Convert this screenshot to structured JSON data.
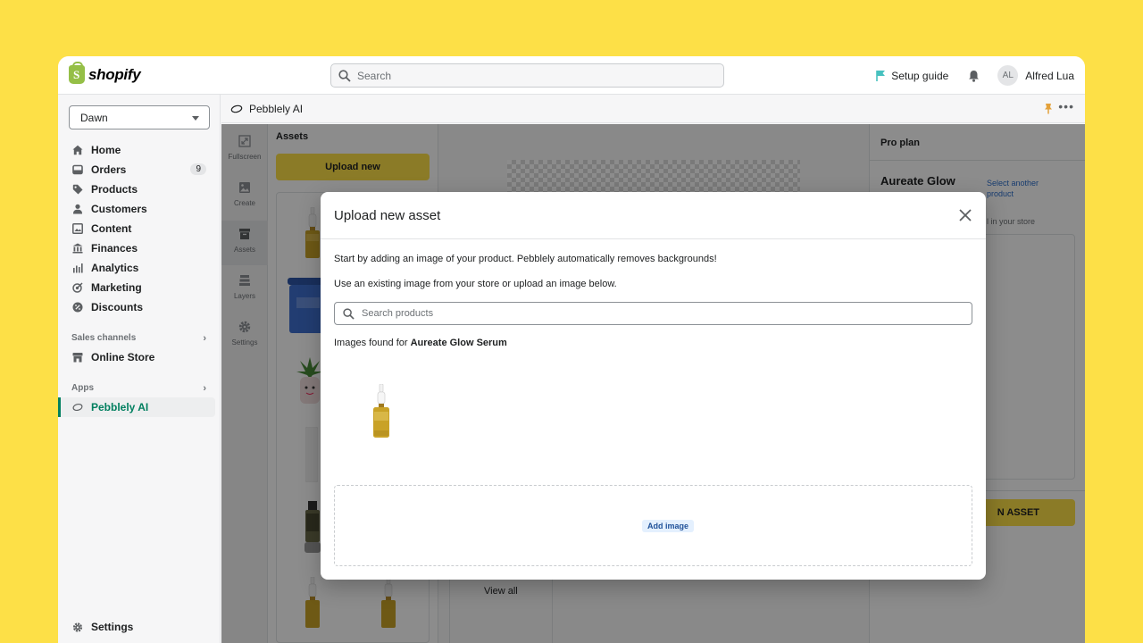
{
  "topbar": {
    "logo_text": "shopify",
    "search_placeholder": "Search",
    "setup_guide": "Setup guide",
    "user_initials": "AL",
    "user_name": "Alfred Lua"
  },
  "sidebar": {
    "store": "Dawn",
    "items": [
      {
        "label": "Home",
        "icon": "home-icon"
      },
      {
        "label": "Orders",
        "icon": "orders-icon",
        "badge": "9"
      },
      {
        "label": "Products",
        "icon": "tag-icon"
      },
      {
        "label": "Customers",
        "icon": "person-icon"
      },
      {
        "label": "Content",
        "icon": "content-icon"
      },
      {
        "label": "Finances",
        "icon": "bank-icon"
      },
      {
        "label": "Analytics",
        "icon": "bar-chart-icon"
      },
      {
        "label": "Marketing",
        "icon": "target-icon"
      },
      {
        "label": "Discounts",
        "icon": "discount-icon"
      }
    ],
    "sales_channels_label": "Sales channels",
    "online_store": "Online Store",
    "apps_label": "Apps",
    "app_item": "Pebblely AI",
    "settings": "Settings"
  },
  "app": {
    "header_title": "Pebblely AI",
    "tools": [
      {
        "label": "Fullscreen",
        "icon": "fullscreen-icon"
      },
      {
        "label": "Create",
        "icon": "image-icon"
      },
      {
        "label": "Assets",
        "icon": "archive-icon"
      },
      {
        "label": "Layers",
        "icon": "layers-icon"
      },
      {
        "label": "Settings",
        "icon": "gear-icon"
      }
    ],
    "assets_title": "Assets",
    "upload_new": "Upload new",
    "view_all": "View all",
    "plan": "Pro plan",
    "product_name": "Aureate Glow",
    "select_another": "Select another product",
    "store_hint": "l in your store",
    "generate_btn": "N ASSET"
  },
  "modal": {
    "title": "Upload new asset",
    "intro": "Start by adding an image of your product. Pebblely automatically removes backgrounds!",
    "existing": "Use an existing image from your store or upload an image below.",
    "search_placeholder": "Search products",
    "found_prefix": "Images found for ",
    "found_product": "Aureate Glow Serum",
    "add_image": "Add image"
  },
  "colors": {
    "background": "#fde047",
    "accent_green": "#008060",
    "link_blue": "#2c6ecb"
  }
}
